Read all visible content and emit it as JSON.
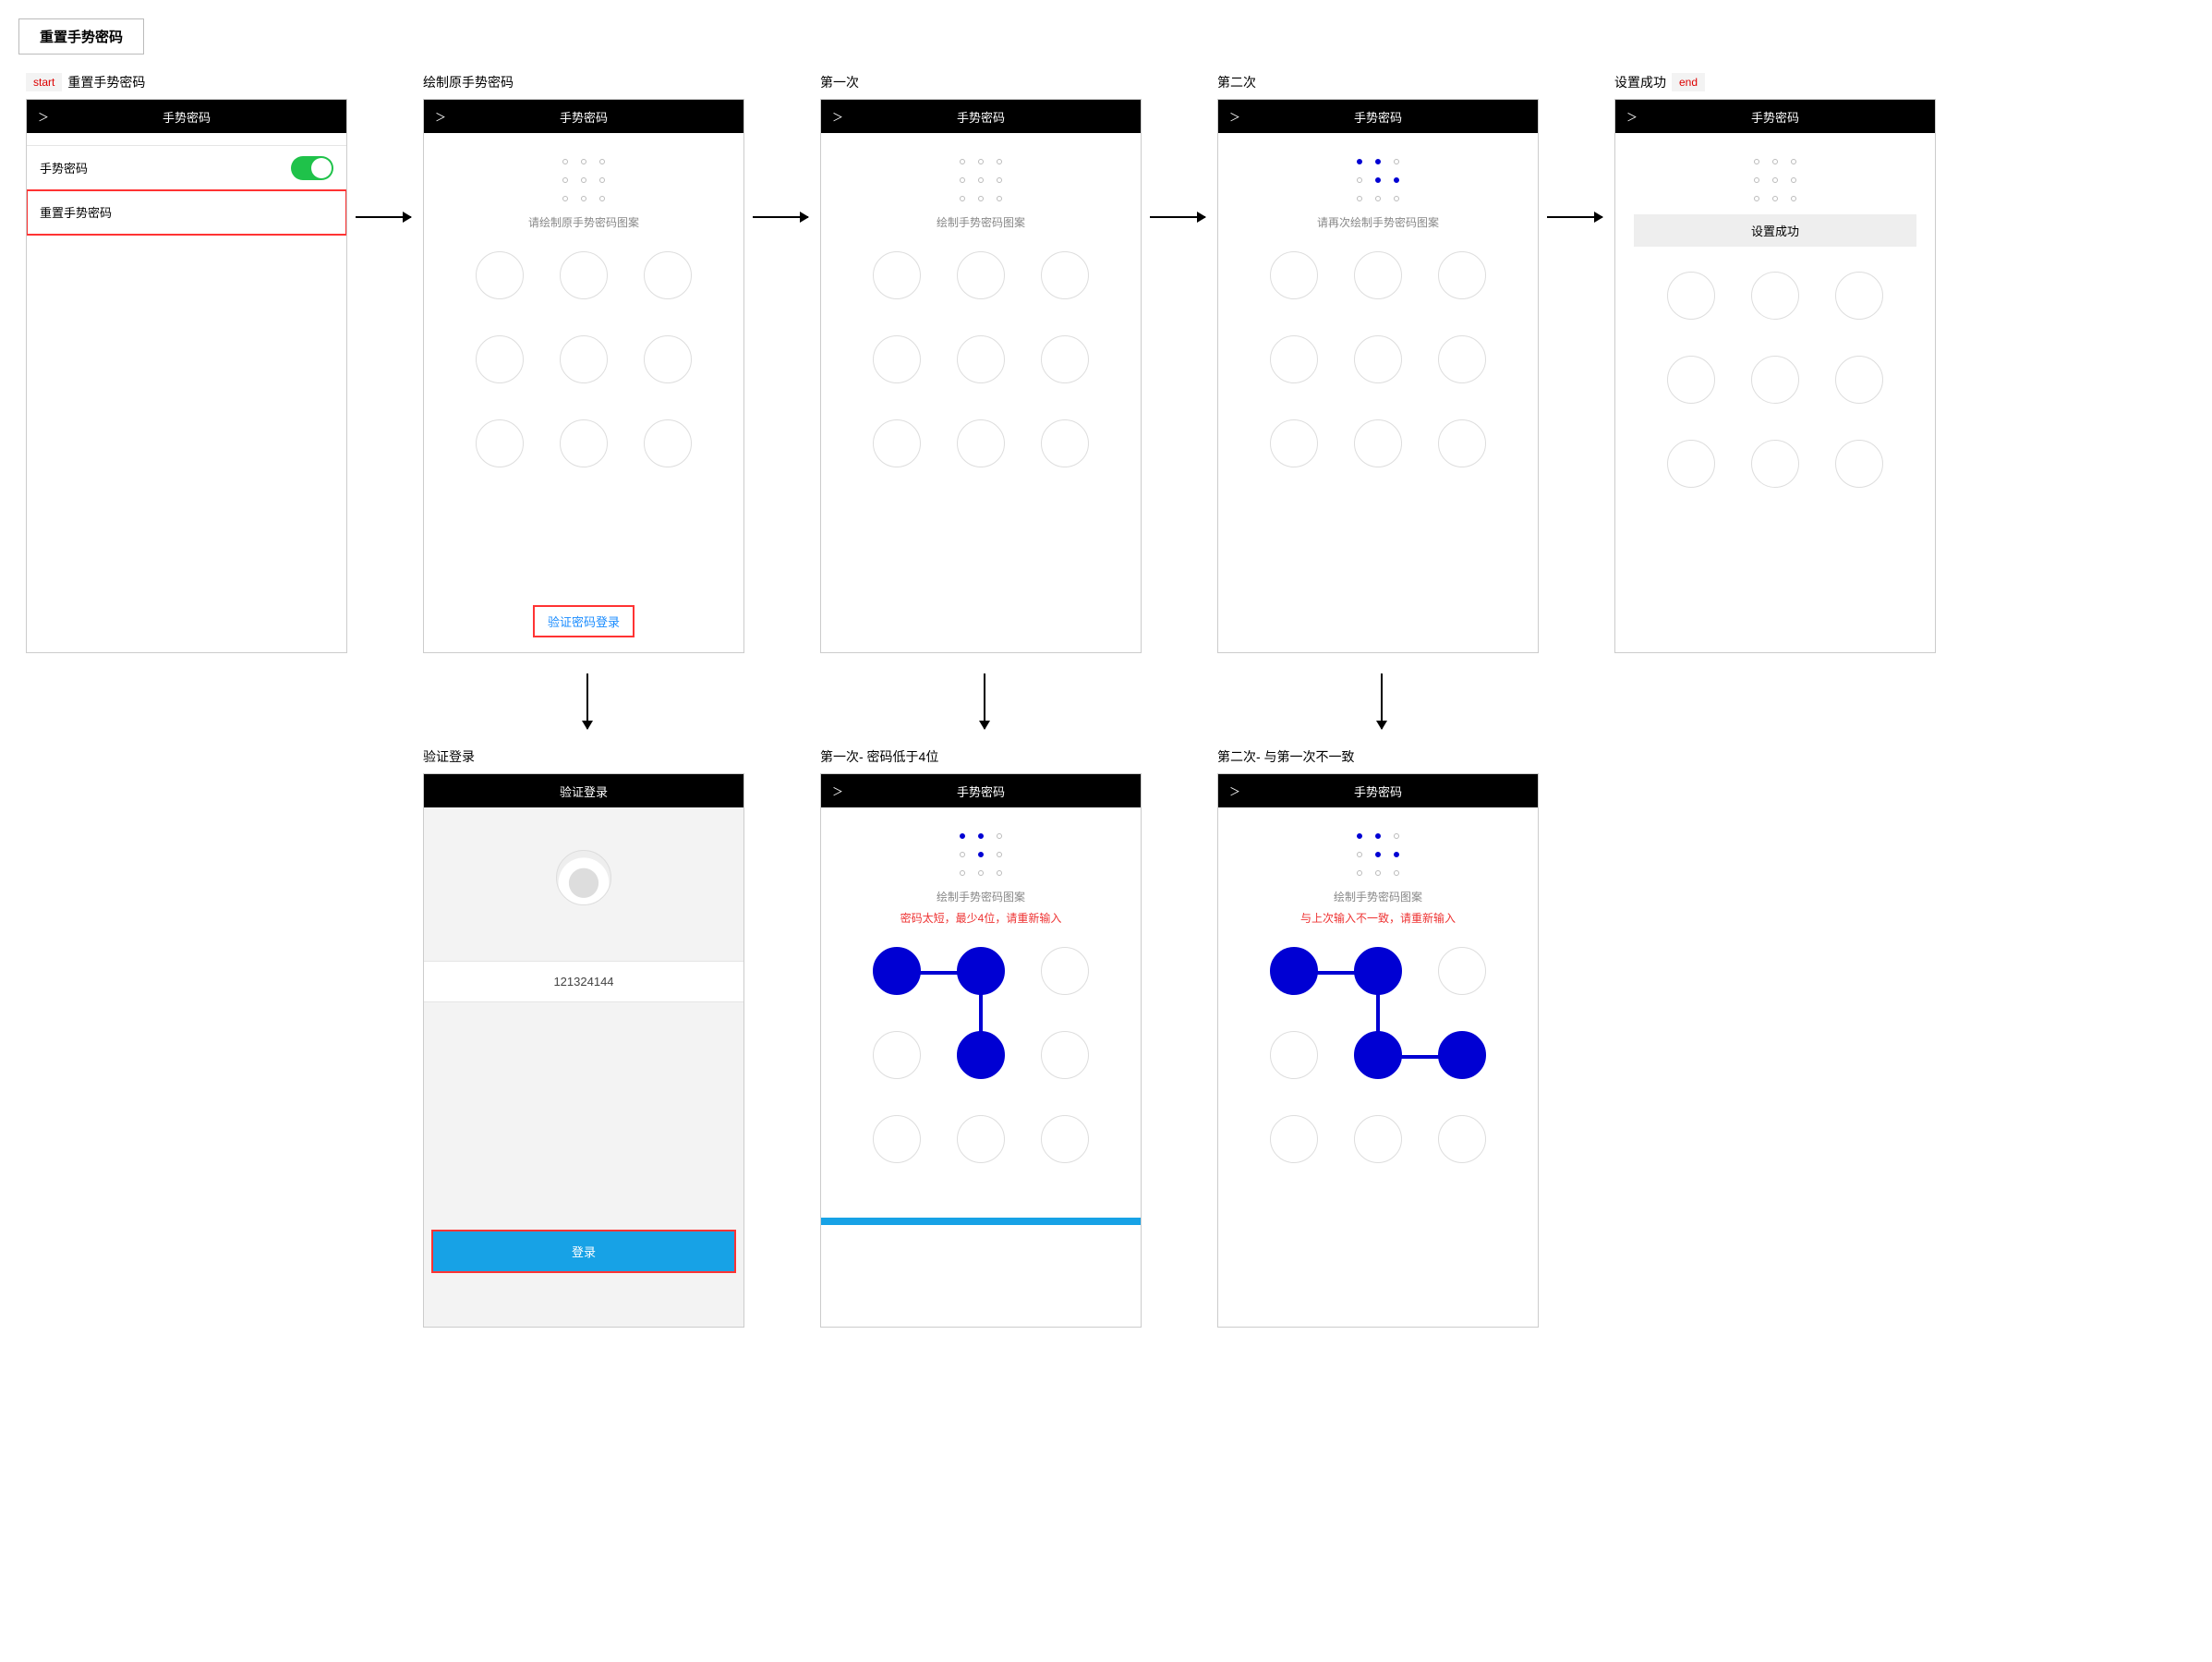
{
  "doc_title": "重置手势密码",
  "tags": {
    "start": "start",
    "end": "end"
  },
  "screens": {
    "s1": {
      "label": "重置手势密码",
      "header": "手势密码",
      "row_toggle_label": "手势密码",
      "row_reset_label": "重置手势密码"
    },
    "s2": {
      "label": "绘制原手势密码",
      "header": "手势密码",
      "hint": "请绘制原手势密码图案",
      "bottom_link": "验证密码登录"
    },
    "s3": {
      "label": "第一次",
      "header": "手势密码",
      "hint": "绘制手势密码图案"
    },
    "s4": {
      "label": "第二次",
      "header": "手势密码",
      "hint": "请再次绘制手势密码图案"
    },
    "s5": {
      "label": "设置成功",
      "header": "手势密码",
      "banner": "设置成功"
    },
    "s6": {
      "label": "验证登录",
      "header": "验证登录",
      "input_value": "121324144",
      "login_btn": "登录"
    },
    "s7": {
      "label": "第一次- 密码低于4位",
      "header": "手势密码",
      "hint": "绘制手势密码图案",
      "error": "密码太短，最少4位，请重新输入"
    },
    "s8": {
      "label": "第二次- 与第一次不一致",
      "header": "手势密码",
      "hint": "绘制手势密码图案",
      "error": "与上次输入不一致，请重新输入"
    }
  }
}
